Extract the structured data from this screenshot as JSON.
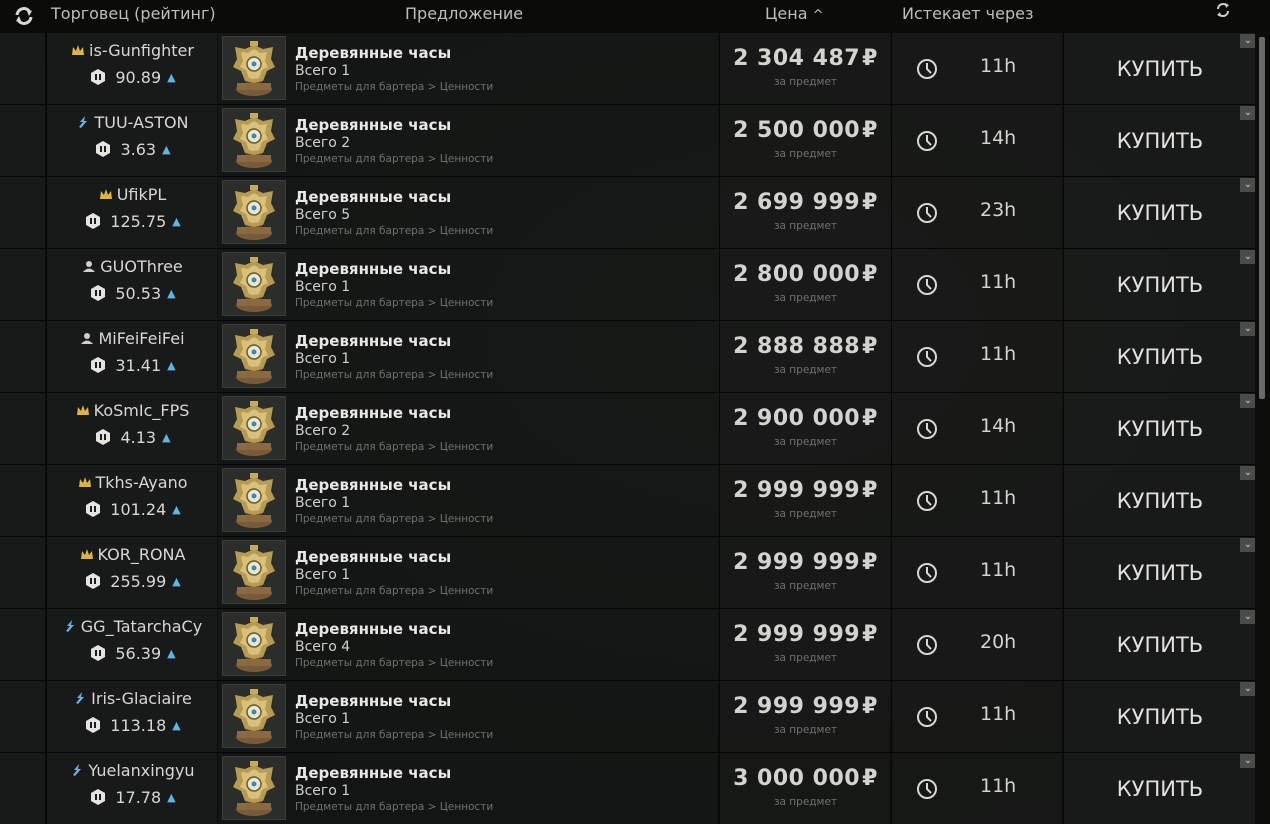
{
  "header": {
    "trader_label": "Торговец (рейтинг)",
    "offer_label": "Предложение",
    "price_label": "Цена",
    "price_sort_indicator": "^",
    "expires_label": "Истекает через"
  },
  "common": {
    "currency_symbol": "₽",
    "per_item_label": "за предмет",
    "buy_label": "КУПИТЬ",
    "item_name": "Деревянные часы",
    "item_category": "Предметы для бартера > Ценности"
  },
  "colors": {
    "rank_gold": "#e0b43a",
    "rank_blue": "#6aaee8",
    "rank_grey": "#cfcfcf",
    "up_arrow": "#5fb6e6"
  },
  "offers": [
    {
      "trader": "is-Gunfighter",
      "rank_icon": "crown-icon",
      "rating": "90.89",
      "item_name": "Деревянные часы",
      "count": "Всего 1",
      "category": "Предметы для бартера > Ценности",
      "price": "2 304 487",
      "expires": "11h"
    },
    {
      "trader": "TUU-ASTON",
      "rank_icon": "bolt-icon",
      "rating": "3.63",
      "item_name": "Деревянные часы",
      "count": "Всего 2",
      "category": "Предметы для бартера > Ценности",
      "price": "2 500 000",
      "expires": "14h"
    },
    {
      "trader": "UfikPL",
      "rank_icon": "crown-icon",
      "rating": "125.75",
      "item_name": "Деревянные часы",
      "count": "Всего 5",
      "category": "Предметы для бартера > Ценности",
      "price": "2 699 999",
      "expires": "23h"
    },
    {
      "trader": "GUOThree",
      "rank_icon": "person-icon",
      "rating": "50.53",
      "item_name": "Деревянные часы",
      "count": "Всего 1",
      "category": "Предметы для бартера > Ценности",
      "price": "2 800 000",
      "expires": "11h"
    },
    {
      "trader": "MiFeiFeiFei",
      "rank_icon": "person-icon",
      "rating": "31.41",
      "item_name": "Деревянные часы",
      "count": "Всего 1",
      "category": "Предметы для бартера > Ценности",
      "price": "2 888 888",
      "expires": "11h"
    },
    {
      "trader": "KoSmIc_FPS",
      "rank_icon": "crown-icon",
      "rating": "4.13",
      "item_name": "Деревянные часы",
      "count": "Всего 2",
      "category": "Предметы для бартера > Ценности",
      "price": "2 900 000",
      "expires": "14h"
    },
    {
      "trader": "Tkhs-Ayano",
      "rank_icon": "crown-icon",
      "rating": "101.24",
      "item_name": "Деревянные часы",
      "count": "Всего 1",
      "category": "Предметы для бартера > Ценности",
      "price": "2 999 999",
      "expires": "11h"
    },
    {
      "trader": "KOR_RONA",
      "rank_icon": "crown-icon",
      "rating": "255.99",
      "item_name": "Деревянные часы",
      "count": "Всего 1",
      "category": "Предметы для бартера > Ценности",
      "price": "2 999 999",
      "expires": "11h"
    },
    {
      "trader": "GG_TatarchaCy",
      "rank_icon": "bolt-icon",
      "rating": "56.39",
      "item_name": "Деревянные часы",
      "count": "Всего 4",
      "category": "Предметы для бартера > Ценности",
      "price": "2 999 999",
      "expires": "20h"
    },
    {
      "trader": "Iris-Glaciaire",
      "rank_icon": "bolt-icon",
      "rating": "113.18",
      "item_name": "Деревянные часы",
      "count": "Всего 1",
      "category": "Предметы для бартера > Ценности",
      "price": "2 999 999",
      "expires": "11h"
    },
    {
      "trader": "Yuelanxingyu",
      "rank_icon": "bolt-icon",
      "rating": "17.78",
      "item_name": "Деревянные часы",
      "count": "Всего 1",
      "category": "Предметы для бартера > Ценности",
      "price": "3 000 000",
      "expires": "11h"
    }
  ]
}
